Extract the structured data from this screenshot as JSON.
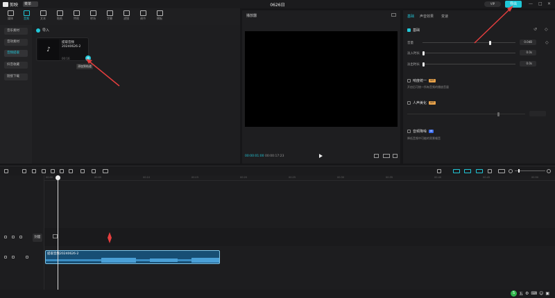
{
  "titlebar": {
    "app_name": "剪映",
    "menu_label": "菜单",
    "project_title": "0626日",
    "vip_label": "VIP",
    "export_label": "导出",
    "controls": [
      "—",
      "□",
      "✕"
    ]
  },
  "toolbar": {
    "items": [
      {
        "label": "媒体",
        "icon": "media-icon"
      },
      {
        "label": "音频",
        "icon": "audio-icon"
      },
      {
        "label": "文本",
        "icon": "text-icon"
      },
      {
        "label": "贴纸",
        "icon": "sticker-icon"
      },
      {
        "label": "特效",
        "icon": "effect-icon"
      },
      {
        "label": "转场",
        "icon": "transition-icon"
      },
      {
        "label": "字幕",
        "icon": "subtitle-icon"
      },
      {
        "label": "滤镜",
        "icon": "filter-icon"
      },
      {
        "label": "调节",
        "icon": "adjust-icon"
      },
      {
        "label": "模板",
        "icon": "template-icon"
      }
    ]
  },
  "leftnav": {
    "items": [
      "音乐素材",
      "音效素材",
      "音频提取",
      "抖音收藏",
      "链接下载"
    ]
  },
  "media": {
    "import_label": "导入",
    "card": {
      "name_line1": "提取音频",
      "name_line2": "20240626-2",
      "duration": "00:16",
      "add_tip": "添加到轨道"
    }
  },
  "player": {
    "title": "播放器",
    "time_current": "00:00:01:00",
    "time_total": "00:00:17:23"
  },
  "right": {
    "tabs": [
      "基础",
      "声音效果",
      "变速"
    ],
    "basic": {
      "title": "基础"
    },
    "volume": {
      "label": "音量",
      "value": "0.0dB"
    },
    "fade_in": {
      "label": "淡入时长",
      "value": "0.0s"
    },
    "fade_out": {
      "label": "淡出时长",
      "value": "0.0s"
    },
    "loudness": {
      "title": "响度统一",
      "vip": "VIP",
      "desc": "开启后可统一所有音频的播放音量"
    },
    "voice": {
      "title": "人声美化",
      "vip": "VIP"
    },
    "noise": {
      "title": "音频降噪",
      "ai": "AI",
      "desc": "降低音频中可能的背景噪音"
    }
  },
  "timeline": {
    "ticks": [
      "00:00",
      "00:05",
      "00:10",
      "00:15",
      "00:20",
      "00:25",
      "00:30",
      "00:35",
      "00:40",
      "00:45",
      "00:50"
    ],
    "cover_label": "封面",
    "audio_clip_name": "提取音频20240626-2"
  },
  "status": {
    "ime_label": "五",
    "ime_icons": [
      "⚙",
      "⌨",
      "☺",
      "▣"
    ]
  }
}
